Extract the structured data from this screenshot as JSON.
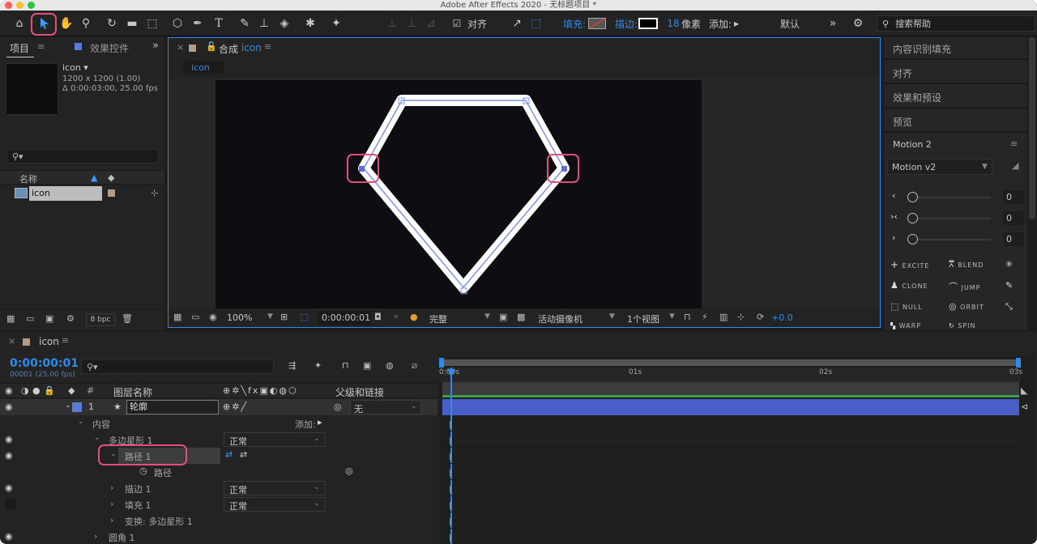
{
  "window": {
    "title": "Adobe After Effects 2020 - 无标题项目 *"
  },
  "toolbar": {
    "align_label": "对齐",
    "fill_label": "填充:",
    "stroke_label": "描边:",
    "stroke_width": "18",
    "stroke_unit": "像素",
    "add_label": "添加:",
    "workspace": "默认",
    "search_placeholder": "搜索帮助"
  },
  "project_panel": {
    "tab_project": "项目",
    "tab_effects": "效果控件",
    "comp_name": "icon ▾",
    "comp_size": "1200 x 1200 (1.00)",
    "comp_duration": "Δ 0:00:03:00, 25.00 fps",
    "col_name": "名称",
    "item_name": "icon",
    "bpc": "8 bpc"
  },
  "comp_panel": {
    "tab_prefix": "合成",
    "tab_name": "icon",
    "breadcrumb": "icon",
    "zoom": "100%",
    "timecode": "0:00:00:01",
    "quality": "完整",
    "camera": "活动摄像机",
    "views": "1个视图",
    "exposure": "+0.0"
  },
  "right_panel": {
    "items": [
      "内容识别填充",
      "对齐",
      "效果和预设",
      "预览"
    ],
    "motion_title": "Motion 2",
    "motion_version": "Motion v2",
    "sliders": [
      {
        "icon": "‹",
        "value": "0"
      },
      {
        "icon": "›‹",
        "value": "0"
      },
      {
        "icon": "›",
        "value": "0"
      }
    ],
    "buttons": [
      [
        "EXCITE",
        "BLEND",
        ""
      ],
      [
        "CLONE",
        "JUMP",
        ""
      ],
      [
        "NULL",
        "ORBIT",
        ""
      ],
      [
        "WARP",
        "SPIN",
        ""
      ]
    ]
  },
  "timeline": {
    "tab": "icon",
    "timecode": "0:00:00:01",
    "frame_info": "00001 (25.00 fps)",
    "col_num": "#",
    "col_layer_name": "图层名称",
    "col_parent": "父级和链接",
    "layer_num": "1",
    "layer_name": "轮廓",
    "parent_value": "无",
    "ruler": [
      "0:00s",
      "01s",
      "02s",
      "03s"
    ],
    "props": [
      {
        "label": "内容",
        "extra": "添加:"
      },
      {
        "label": "多边星形 1",
        "mode": "正常"
      },
      {
        "label": "路径 1"
      },
      {
        "label": "路径"
      },
      {
        "label": "描边 1",
        "mode": "正常"
      },
      {
        "label": "填充 1",
        "mode": "正常"
      },
      {
        "label": "变换: 多边星形 1"
      },
      {
        "label": "圆角 1"
      }
    ]
  }
}
